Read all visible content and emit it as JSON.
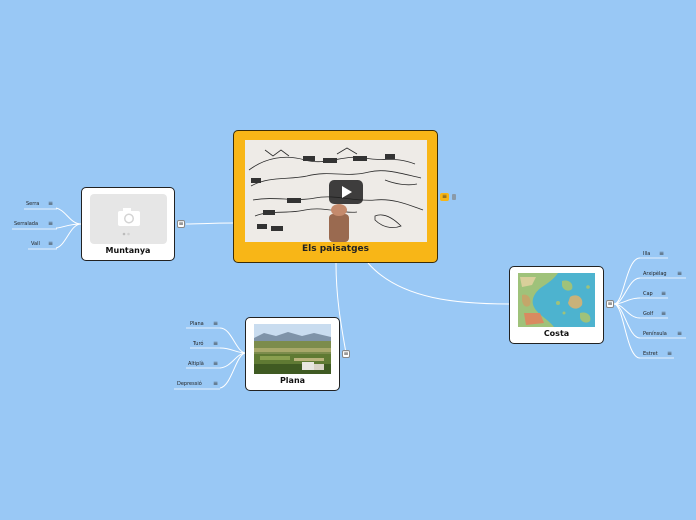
{
  "central": {
    "title": "Els paisatges"
  },
  "topics": {
    "muntanya": {
      "title": "Muntanya",
      "children": [
        "Serra",
        "Serralada",
        "Vall"
      ]
    },
    "plana": {
      "title": "Plana",
      "children": [
        "Plana",
        "Turó",
        "Altiplà",
        "Depressió"
      ]
    },
    "costa": {
      "title": "Costa",
      "children": [
        "Illa",
        "Arxipèlag",
        "Cap",
        "Golf",
        "Península",
        "Estret"
      ]
    }
  },
  "icons": {
    "menu": "hamburger-icon",
    "placeholder": "camera-icon",
    "play": "play-icon"
  },
  "colors": {
    "background": "#99c8f5",
    "central": "#f8b617",
    "link": "#ffffff"
  }
}
